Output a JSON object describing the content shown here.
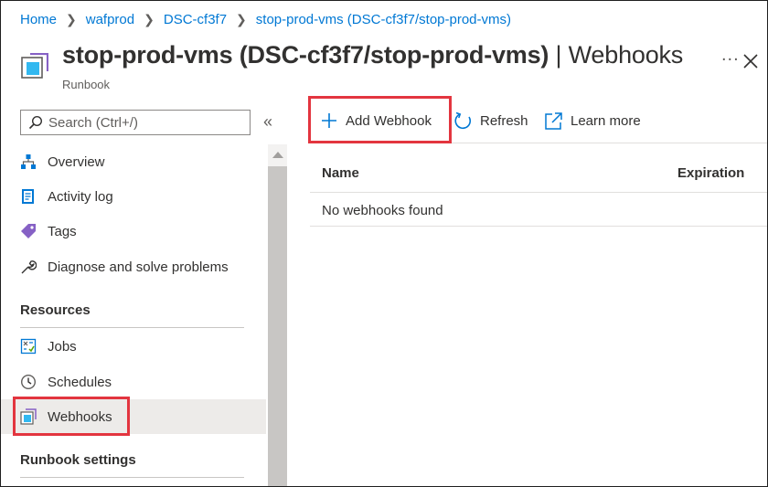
{
  "breadcrumb": [
    {
      "label": "Home"
    },
    {
      "label": "wafprod"
    },
    {
      "label": "DSC-cf3f7"
    },
    {
      "label": "stop-prod-vms (DSC-cf3f7/stop-prod-vms)"
    }
  ],
  "header": {
    "title": "stop-prod-vms (DSC-cf3f7/stop-prod-vms)",
    "title_suffix": " | Webhooks",
    "subtitle": "Runbook",
    "more": "...",
    "icon": "runbook-icon"
  },
  "sidebar": {
    "search_placeholder": "Search (Ctrl+/)",
    "collapse": "«",
    "items": [
      {
        "label": "Overview",
        "icon": "overview-icon"
      },
      {
        "label": "Activity log",
        "icon": "activity-log-icon"
      },
      {
        "label": "Tags",
        "icon": "tag-icon"
      },
      {
        "label": "Diagnose and solve problems",
        "icon": "wrench-icon"
      }
    ],
    "sections": [
      {
        "title": "Resources",
        "items": [
          {
            "label": "Jobs",
            "icon": "jobs-icon"
          },
          {
            "label": "Schedules",
            "icon": "clock-icon"
          },
          {
            "label": "Webhooks",
            "icon": "webhook-icon",
            "selected": true
          }
        ]
      },
      {
        "title": "Runbook settings",
        "items": []
      }
    ]
  },
  "toolbar": {
    "add_label": "Add Webhook",
    "refresh_label": "Refresh",
    "learn_label": "Learn more"
  },
  "table": {
    "columns": [
      "Name",
      "Expiration"
    ],
    "empty_message": "No webhooks found"
  },
  "colors": {
    "accent": "#0078d4",
    "highlight": "#e3353f",
    "selected_bg": "#edebe9"
  }
}
